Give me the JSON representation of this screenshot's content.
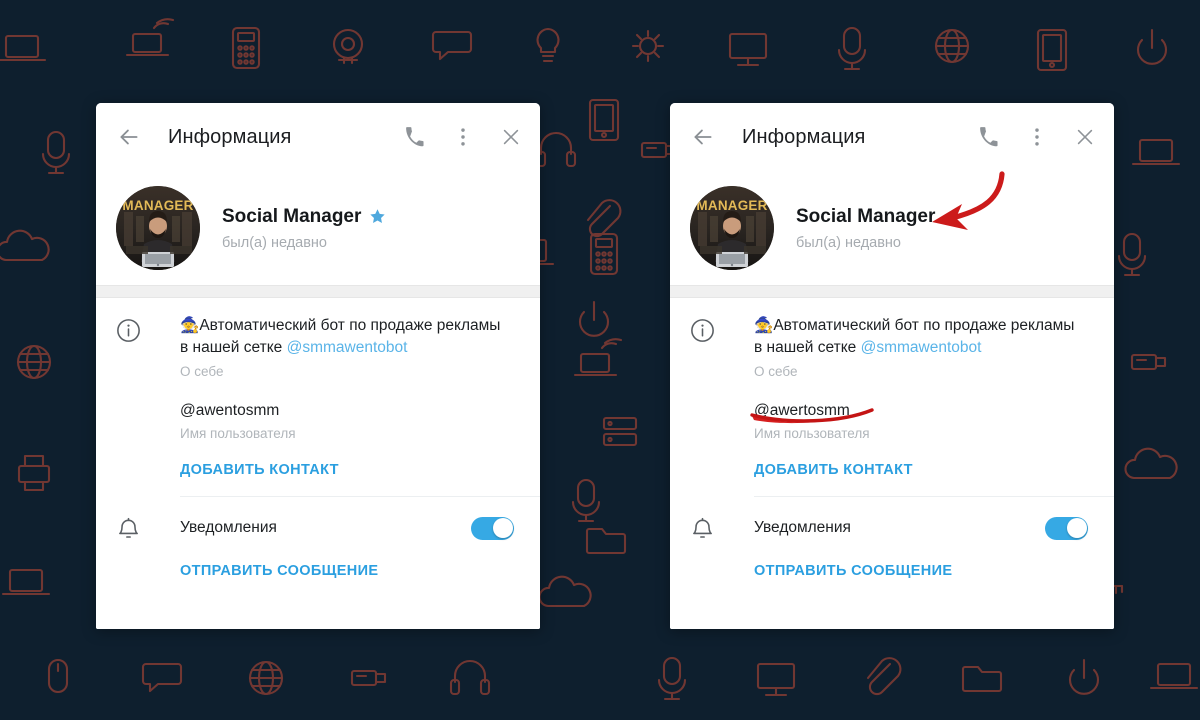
{
  "theme": {
    "background_color": "#0e1f2e",
    "wallpaper_icon_color": "#7b3a34",
    "accent_color": "#2b9fe0",
    "toggle_on_color": "#36a9e4",
    "mention_color": "#5ab4e8",
    "annotation_color": "#cc1b1b",
    "panel_background": "#ffffff",
    "separator_color": "#f0f0f0"
  },
  "panels": [
    {
      "id": "left",
      "header": {
        "title": "Информация",
        "back_icon": "arrow-left-icon",
        "call_icon": "phone-icon",
        "menu_icon": "more-vertical-icon",
        "close_icon": "close-icon"
      },
      "profile": {
        "avatar_label": "MANAGER",
        "name": "Social Manager",
        "verified_badge": "star-icon",
        "has_badge": true,
        "status": "был(а) недавно"
      },
      "info": {
        "icon": "info-circle-icon",
        "bio_emoji": "🧙",
        "bio_text_line1": "Автоматический бот по продаже рекламы",
        "bio_text_line2": "в нашей сетке ",
        "bio_mention": "@smmawentobot",
        "bio_label": "О себе",
        "username_value": "@awentosmm",
        "username_label": "Имя пользователя",
        "add_contact_label": "ДОБАВИТЬ КОНТАКТ"
      },
      "notifications": {
        "icon": "bell-icon",
        "label": "Уведомления",
        "enabled": true
      },
      "send_message_label": "ОТПРАВИТЬ СООБЩЕНИЕ",
      "annotations": []
    },
    {
      "id": "right",
      "header": {
        "title": "Информация",
        "back_icon": "arrow-left-icon",
        "call_icon": "phone-icon",
        "menu_icon": "more-vertical-icon",
        "close_icon": "close-icon"
      },
      "profile": {
        "avatar_label": "MANAGER",
        "name": "Social Manager",
        "verified_badge": "star-icon",
        "has_badge": false,
        "status": "был(а) недавно"
      },
      "info": {
        "icon": "info-circle-icon",
        "bio_emoji": "🧙",
        "bio_text_line1": "Автоматический бот по продаже рекламы",
        "bio_text_line2": "в нашей сетке ",
        "bio_mention": "@smmawentobot",
        "bio_label": "О себе",
        "username_value": "@awertosmm",
        "username_label": "Имя пользователя",
        "add_contact_label": "ДОБАВИТЬ КОНТАКТ"
      },
      "notifications": {
        "icon": "bell-icon",
        "label": "Уведомления",
        "enabled": true
      },
      "send_message_label": "ОТПРАВИТЬ СООБЩЕНИЕ",
      "annotations": [
        {
          "type": "arrow",
          "name": "red-arrow-annotation",
          "points_to": "Social Manager"
        },
        {
          "type": "underline",
          "name": "red-underline-annotation",
          "underlines": "@awertosmm"
        }
      ]
    }
  ]
}
